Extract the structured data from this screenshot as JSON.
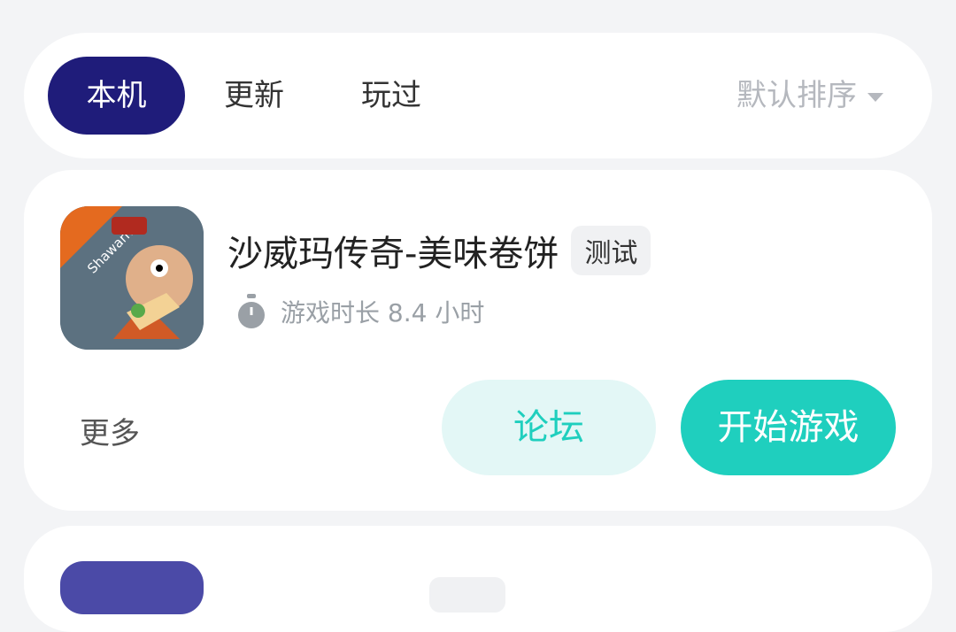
{
  "tabs": {
    "items": [
      {
        "label": "本机",
        "active": true
      },
      {
        "label": "更新",
        "active": false
      },
      {
        "label": "玩过",
        "active": false
      }
    ],
    "sort": "默认排序"
  },
  "games": [
    {
      "title": "沙威玛传奇-美味卷饼",
      "badge": "测试",
      "icon_text": "Shawarma",
      "playtime": "游戏时长 8.4 小时",
      "more_label": "更多",
      "forum_label": "论坛",
      "play_label": "开始游戏"
    }
  ],
  "colors": {
    "active_tab": "#1f1c7a",
    "accent": "#1fcfbe",
    "accent_light": "#e3f7f6"
  }
}
